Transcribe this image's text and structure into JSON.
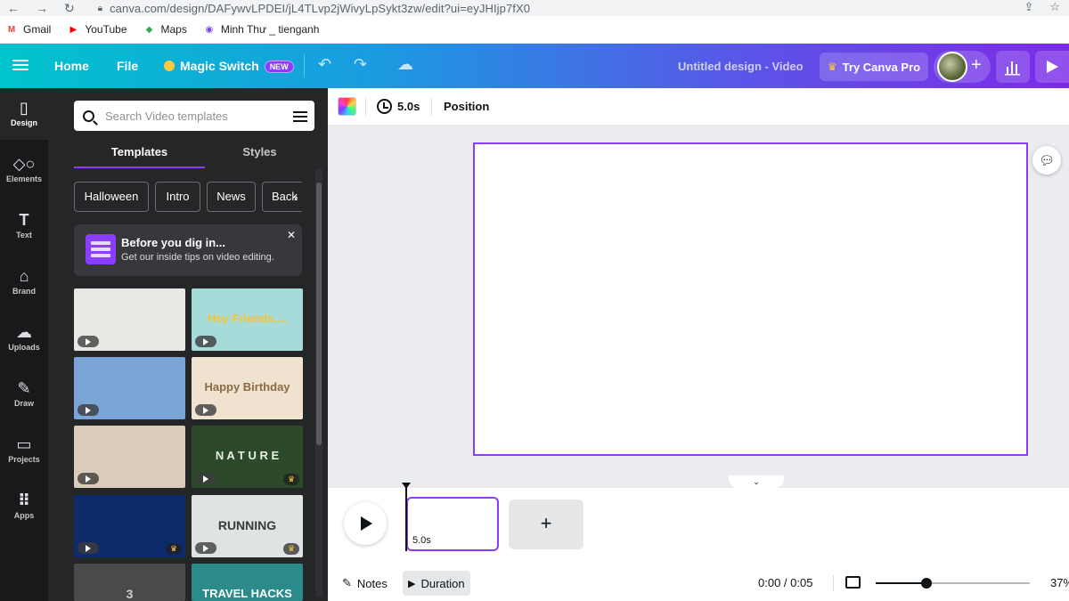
{
  "browser": {
    "url_host": "canva.com",
    "url_path": "/design/DAFywvLPDEI/jL4TLvp2jWivyLpSykt3zw/edit?ui=eyJHIjp7fX0",
    "bookmarks": [
      {
        "label": "Gmail",
        "icon": "gmail-icon",
        "color": "#ea4335"
      },
      {
        "label": "YouTube",
        "icon": "youtube-icon",
        "color": "#ff0000"
      },
      {
        "label": "Maps",
        "icon": "maps-icon",
        "color": "#34a853"
      },
      {
        "label": "Minh Thư _ tienganh",
        "icon": "bookmark-app-icon",
        "color": "#7b3fe4"
      }
    ]
  },
  "topbar": {
    "home": "Home",
    "file": "File",
    "magic_switch": "Magic Switch",
    "new_badge": "NEW",
    "doc_title": "Untitled design - Video",
    "try_pro": "Try Canva Pro",
    "gradient_colors": [
      "#00c4cc",
      "#7d2ae8"
    ]
  },
  "rail": [
    {
      "label": "Design",
      "icon": "design-icon",
      "glyph": "▯",
      "active": true
    },
    {
      "label": "Elements",
      "icon": "elements-icon",
      "glyph": "◇○",
      "active": false
    },
    {
      "label": "Text",
      "icon": "text-icon",
      "glyph": "T",
      "active": false
    },
    {
      "label": "Brand",
      "icon": "brand-icon",
      "glyph": "⌂",
      "active": false
    },
    {
      "label": "Uploads",
      "icon": "uploads-icon",
      "glyph": "☁",
      "active": false
    },
    {
      "label": "Draw",
      "icon": "draw-icon",
      "glyph": "✎",
      "active": false
    },
    {
      "label": "Projects",
      "icon": "projects-icon",
      "glyph": "▭",
      "active": false
    },
    {
      "label": "Apps",
      "icon": "apps-icon",
      "glyph": "⠿",
      "active": false
    }
  ],
  "panel": {
    "search_placeholder": "Search Video templates",
    "tabs": [
      "Templates",
      "Styles"
    ],
    "chips": [
      "Halloween",
      "Intro",
      "News",
      "Back"
    ],
    "tip_title": "Before you dig in...",
    "tip_text": "Get our inside tips on video editing.",
    "thumbnails": [
      {
        "name": "template-clapper",
        "text": "",
        "bg": "#e9e8e4",
        "fg": "#333",
        "premium": false
      },
      {
        "name": "template-hey-friends",
        "text": "Hey Friends....",
        "bg": "#a7dbd9",
        "fg": "#f5c33b",
        "premium": false
      },
      {
        "name": "template-sky",
        "text": "",
        "bg": "#7aa5d6",
        "fg": "#fff",
        "premium": false
      },
      {
        "name": "template-birthday",
        "text": "Happy Birthday",
        "bg": "#efe2cf",
        "fg": "#8a6a44",
        "premium": false
      },
      {
        "name": "template-photos",
        "text": "",
        "bg": "#d9cdb9",
        "fg": "#333",
        "premium": false
      },
      {
        "name": "template-nature",
        "text": "N A T U R E",
        "bg": "#2c4a2a",
        "fg": "#e8efe4",
        "premium": true
      },
      {
        "name": "template-blue-glow",
        "text": "",
        "bg": "#0d2a6b",
        "fg": "#9fc9ff",
        "premium": true
      },
      {
        "name": "template-running",
        "text": "RUNNING",
        "bg": "#dfe3e4",
        "fg": "#3a3a3a",
        "premium": true
      },
      {
        "name": "template-countdown",
        "text": "3",
        "bg": "#4a4a4a",
        "fg": "#cfcfcf",
        "premium": false
      },
      {
        "name": "template-travel",
        "text": "TRAVEL HACKS",
        "bg": "#2b8a8a",
        "fg": "#ffffff",
        "premium": false
      }
    ]
  },
  "editor": {
    "duration": "5.0s",
    "position": "Position",
    "accent": "#8b3dff"
  },
  "timeline": {
    "clip_duration": "5.0s",
    "add": "+"
  },
  "footer": {
    "notes": "Notes",
    "duration": "Duration",
    "time": "0:00 / 0:05",
    "zoom": "37%",
    "zoom_level": 0.33
  }
}
